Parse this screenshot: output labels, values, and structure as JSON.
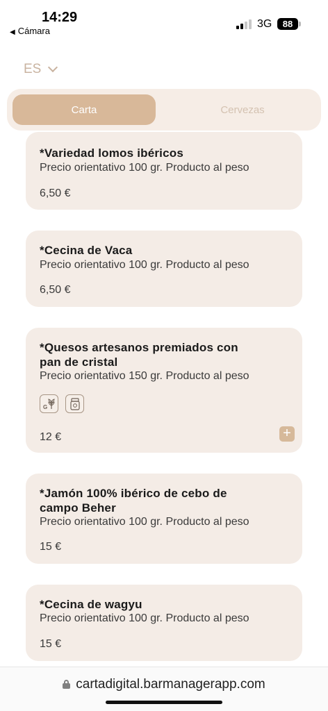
{
  "status_bar": {
    "time": "14:29",
    "back_app": "Cámara",
    "back_glyph": "◀",
    "network": "3G",
    "battery": "88"
  },
  "language": {
    "code": "ES",
    "icon": "chevron-down-icon"
  },
  "tabs": [
    {
      "label": "Carta",
      "active": true
    },
    {
      "label": "Cervezas",
      "active": false
    }
  ],
  "products": [
    {
      "name": "*Variedad lomos ibéricos",
      "description": "Precio orientativo 100 gr. Producto al peso",
      "price": "6,50 €"
    },
    {
      "name": "*Cecina de Vaca",
      "description": "Precio orientativo 100 gr. Producto al peso",
      "price": "6,50 €"
    },
    {
      "name_line1": "*Quesos artesanos premiados con",
      "name_line2": "pan de cristal",
      "description": "Precio orientativo 150 gr. Producto al peso",
      "allergens": [
        "gluten-icon",
        "milk-icon"
      ],
      "price": "12 €",
      "add_label": "+"
    },
    {
      "name_line1": "*Jamón 100% ibérico de cebo de",
      "name_line2": "campo Beher",
      "description": "Precio orientativo 100 gr. Producto al peso",
      "price": "15 €"
    },
    {
      "name": "*Cecina de wagyu",
      "description": "Precio orientativo 100 gr. Producto al peso",
      "price": "15 €"
    }
  ],
  "browser": {
    "url": "cartadigital.barmanagerapp.com"
  },
  "colors": {
    "accent": "#d8b899",
    "card_bg": "#f4ece6",
    "tabs_bg": "#f6ede6",
    "lang_text": "#c9b3a0",
    "inactive_tab_text": "#d4c2b1"
  }
}
